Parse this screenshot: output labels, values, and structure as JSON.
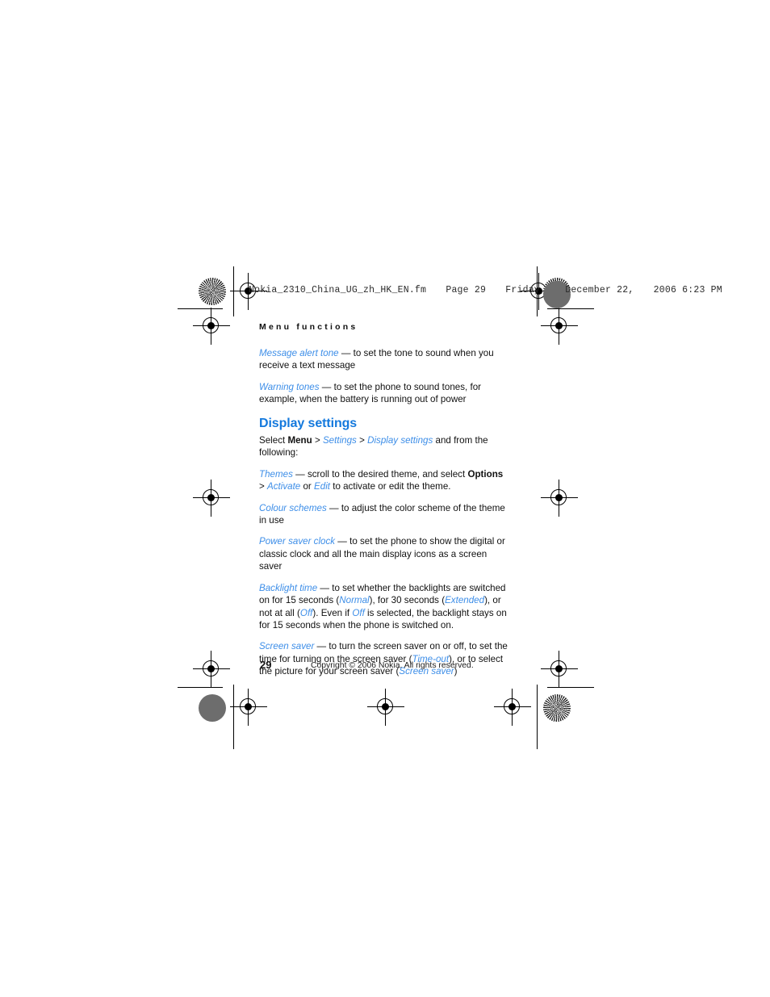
{
  "file_header": {
    "filename": "Nokia_2310_China_UG_zh_HK_EN.fm",
    "page_label": "Page 29",
    "day": "Friday,",
    "month_day": "December 22,",
    "year_time": "2006 6:23 PM"
  },
  "page": {
    "running_head": "Menu functions",
    "page_number": "29",
    "copyright": "Copyright © 2006 Nokia. All rights reserved."
  },
  "colors": {
    "heading_blue": "#1479dd",
    "italic_blue": "#3d8ee8",
    "body_black": "#111111"
  },
  "content": {
    "para_message_alert_tone": {
      "term": "Message alert tone",
      "dash": " — ",
      "body": "to set the tone to sound when you receive a text message"
    },
    "para_warning_tones": {
      "term": "Warning tones",
      "dash": " — ",
      "body": "to set the phone to sound tones, for example, when the battery is running out of power"
    },
    "section_title": "Display settings",
    "para_select": {
      "lead": "Select ",
      "menu": "Menu",
      "gt1": " > ",
      "settings": "Settings",
      "gt2": " > ",
      "display_settings": "Display settings",
      "tail": " and from the following:"
    },
    "para_themes": {
      "term": "Themes",
      "dash": " — ",
      "body1": "scroll to the desired theme, and select ",
      "options": "Options",
      "gt": " > ",
      "activate": "Activate",
      "or": " or ",
      "edit": "Edit",
      "body2": " to activate or edit the theme."
    },
    "para_colour_schemes": {
      "term": "Colour schemes",
      "dash": " — ",
      "body": "to adjust the color scheme of the theme in use"
    },
    "para_power_saver_clock": {
      "term": "Power saver clock",
      "dash": " — ",
      "body": "to set the phone to show the digital or classic clock and all the main display icons as a screen saver"
    },
    "para_backlight_time": {
      "term": "Backlight time",
      "dash": " — ",
      "body1": "to set whether the backlights are switched on for 15 seconds (",
      "normal": "Normal",
      "body2": "), for 30 seconds (",
      "extended": "Extended",
      "body3": "), or not at all (",
      "off1": "Off",
      "body4": "). Even if ",
      "off2": "Off",
      "body5": " is selected, the backlight stays on for 15 seconds when the phone is switched on."
    },
    "para_screen_saver": {
      "term": "Screen saver",
      "dash": " — ",
      "body1": "to turn the screen saver on or off, to set the time for turning on the screen saver (",
      "timeout": "Time-out",
      "body2": "), or to select the picture for your screen saver (",
      "screen_saver": "Screen saver",
      "body3": ")"
    }
  }
}
